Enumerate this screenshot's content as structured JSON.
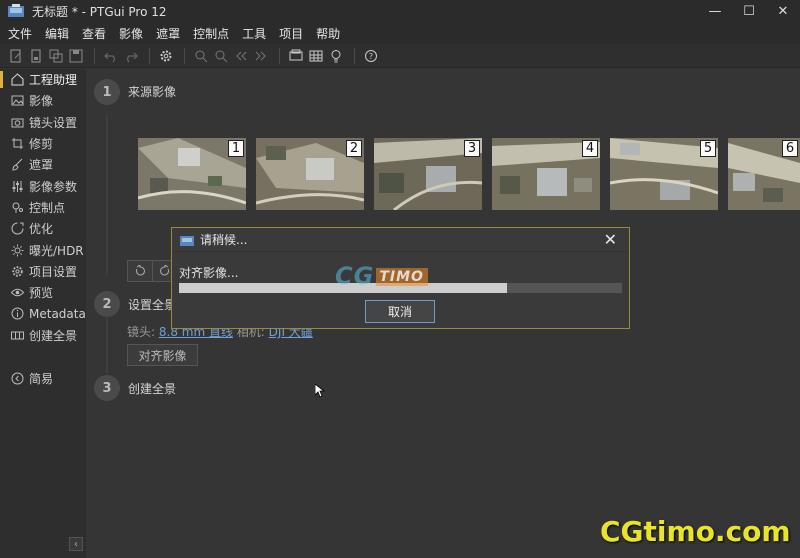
{
  "window": {
    "title": "无标题 * - PTGui Pro 12",
    "minimize": "—",
    "maximize": "☐",
    "close": "✕"
  },
  "menu": [
    "文件",
    "编辑",
    "查看",
    "影像",
    "遮罩",
    "控制点",
    "工具",
    "项目",
    "帮助"
  ],
  "sidebar": {
    "items": [
      {
        "label": "工程助理",
        "icon": "home-icon",
        "active": true
      },
      {
        "label": "影像",
        "icon": "image-icon"
      },
      {
        "label": "镜头设置",
        "icon": "camera-icon"
      },
      {
        "label": "修剪",
        "icon": "crop-icon"
      },
      {
        "label": "遮罩",
        "icon": "brush-icon"
      },
      {
        "label": "影像参数",
        "icon": "sliders-icon"
      },
      {
        "label": "控制点",
        "icon": "pin-icon"
      },
      {
        "label": "优化",
        "icon": "optimize-icon"
      },
      {
        "label": "曝光/HDR",
        "icon": "sun-icon"
      },
      {
        "label": "项目设置",
        "icon": "gear-icon"
      },
      {
        "label": "预览",
        "icon": "eye-icon"
      },
      {
        "label": "Metadata",
        "icon": "info-icon"
      },
      {
        "label": "创建全景",
        "icon": "panorama-icon"
      }
    ],
    "simple_label": "简易",
    "collapse": "‹"
  },
  "steps": [
    {
      "number": "1",
      "title": "来源影像"
    },
    {
      "number": "2",
      "title": "设置全景"
    },
    {
      "number": "3",
      "title": "创建全景"
    }
  ],
  "thumbnails": [
    "1",
    "2",
    "3",
    "4",
    "5",
    "6"
  ],
  "lens": {
    "label": "镜头:",
    "value": "8.8 mm 直线",
    "label2": "相机:",
    "value2": "DJI 大疆"
  },
  "align_button": "对齐影像",
  "dialog": {
    "title": "请稍候...",
    "close": "✕",
    "message": "对齐影像...",
    "progress": 0.74,
    "cancel": "取消"
  },
  "watermark": {
    "mid_main": "CG",
    "mid_tail": "TIMO",
    "corner": "CGtimo.com"
  }
}
